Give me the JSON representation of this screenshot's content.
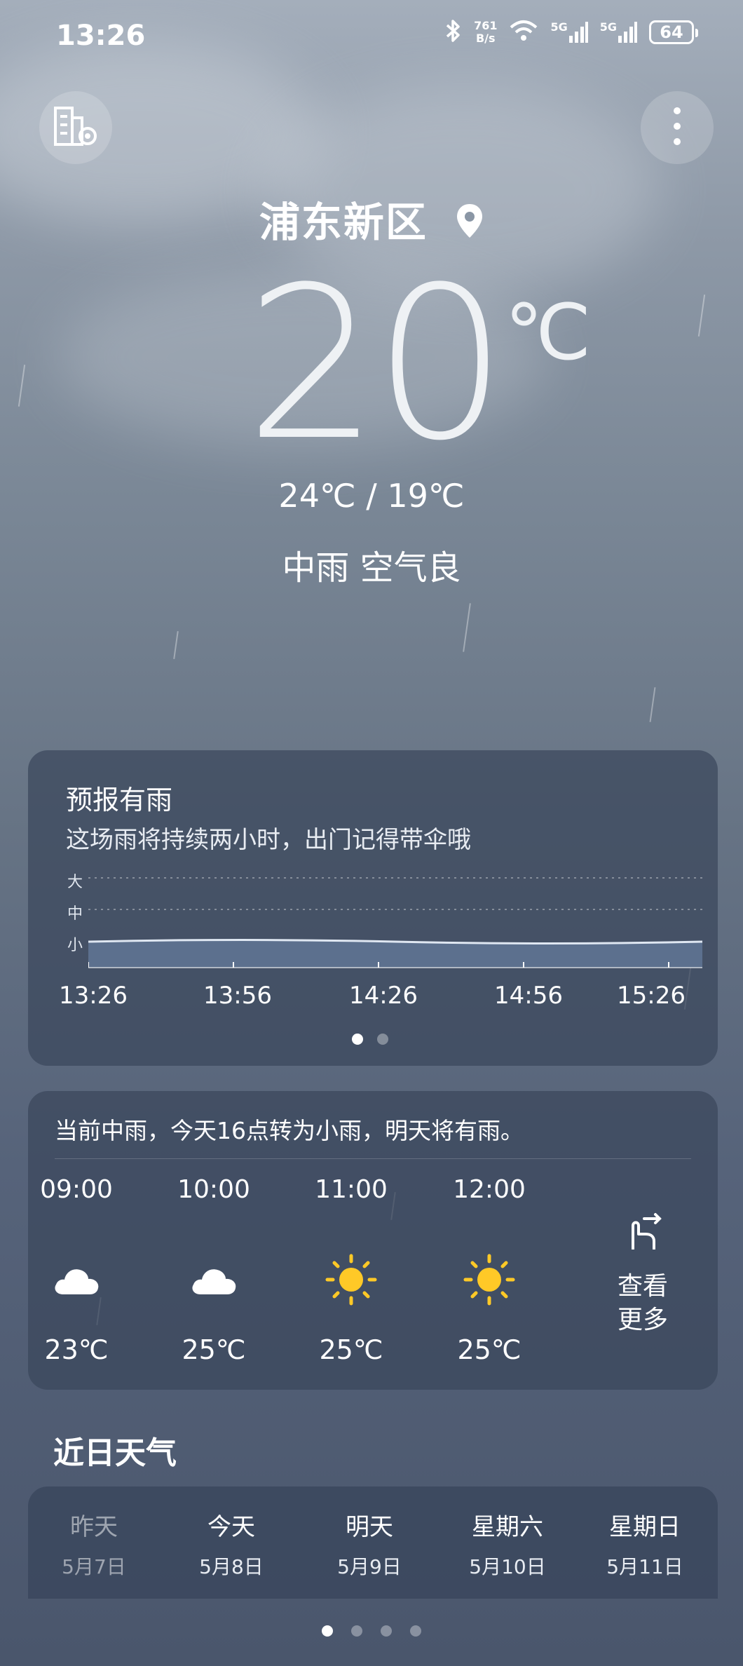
{
  "status_bar": {
    "time": "13:26",
    "net_speed_value": "761",
    "net_speed_unit": "B/s",
    "signal_1_label": "5G",
    "signal_2_label": "5G",
    "battery": "64"
  },
  "location": "浦东新区",
  "current": {
    "temperature": "20",
    "unit": "℃",
    "range": "24℃ / 19℃",
    "condition": "中雨  空气良"
  },
  "rain_forecast": {
    "title": "预报有雨",
    "subtitle": "这场雨将持续两小时，出门记得带伞哦",
    "y_levels": [
      "大",
      "中",
      "小"
    ],
    "times": [
      "13:26",
      "13:56",
      "14:26",
      "14:56",
      "15:26"
    ],
    "intensity_level": "小",
    "active_page": 1,
    "pages": 2
  },
  "hourly": {
    "summary": "当前中雨，今天16点转为小雨，明天将有雨。",
    "hours": [
      {
        "time": "09:00",
        "icon": "cloud-icon",
        "temp": "23℃"
      },
      {
        "time": "10:00",
        "icon": "cloud-icon",
        "temp": "25℃"
      },
      {
        "time": "11:00",
        "icon": "sun-icon",
        "temp": "25℃"
      },
      {
        "time": "12:00",
        "icon": "sun-icon",
        "temp": "25℃"
      }
    ],
    "more_line1": "查看",
    "more_line2": "更多"
  },
  "daily": {
    "title": "近日天气",
    "days": [
      {
        "name": "昨天",
        "date": "5月7日"
      },
      {
        "name": "今天",
        "date": "5月8日"
      },
      {
        "name": "明天",
        "date": "5月9日"
      },
      {
        "name": "星期六",
        "date": "5月10日"
      },
      {
        "name": "星期日",
        "date": "5月11日"
      }
    ]
  },
  "page_indicator": {
    "pages": 4,
    "active": 1
  }
}
